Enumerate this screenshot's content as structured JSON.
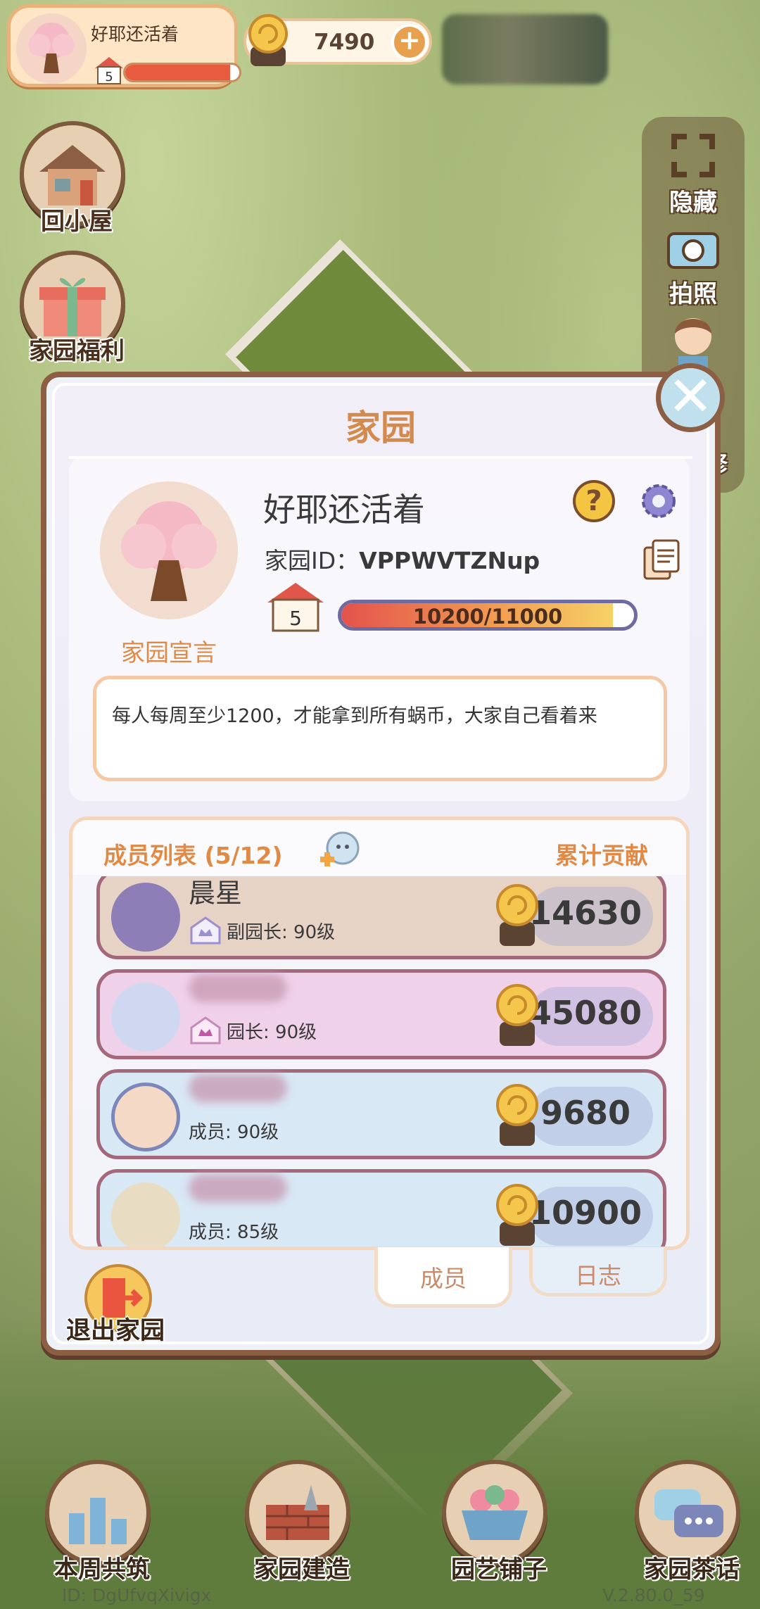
{
  "hud": {
    "player_name": "好耶还活着",
    "player_level": "5",
    "player_exp_progress": 0.92,
    "coins": "7490",
    "coin_add": "+"
  },
  "left_menu": {
    "home_label": "回小屋",
    "welfare_label": "家园福利"
  },
  "right_menu": {
    "hide_label": "隐藏",
    "photo_label": "拍照",
    "repair_label": "修"
  },
  "dialog": {
    "title": "家园",
    "close": "✕",
    "home_name": "好耶还活着",
    "home_id_label": "家园ID：",
    "home_id": "VPPWVTZNup",
    "help": "?",
    "level": "5",
    "exp_text": "10200/11000",
    "exp_progress": 0.927,
    "declaration_label": "家园宣言",
    "declaration": "每人每周至少1200，才能拿到所有蜗币，大家自己看着来"
  },
  "members": {
    "header_title": "成员列表 (5/12)",
    "header_contrib": "累计贡献",
    "rows": [
      {
        "name": "晨星",
        "role": "副园长: 90级",
        "contribution": "14630",
        "bg": "#e6d3c6"
      },
      {
        "name": "",
        "role": "园长: 90级",
        "contribution": "45080",
        "bg": "#f0d1ea"
      },
      {
        "name": "",
        "role": "成员: 90级",
        "contribution": "9680",
        "bg": "#d9e8f5"
      },
      {
        "name": "",
        "role": "成员: 85级",
        "contribution": "10900",
        "bg": "#d9e8f5"
      }
    ]
  },
  "tabs": {
    "members": "成员",
    "log": "日志"
  },
  "exit_label": "退出家园",
  "bottom_menu": {
    "weekly_label": "本周共筑",
    "build_label": "家园建造",
    "garden_shop_label": "园艺铺子",
    "chat_label": "家园茶话"
  },
  "footer": {
    "id": "ID: DgUfvqXivigx",
    "version": "V.2.80.0_59"
  }
}
